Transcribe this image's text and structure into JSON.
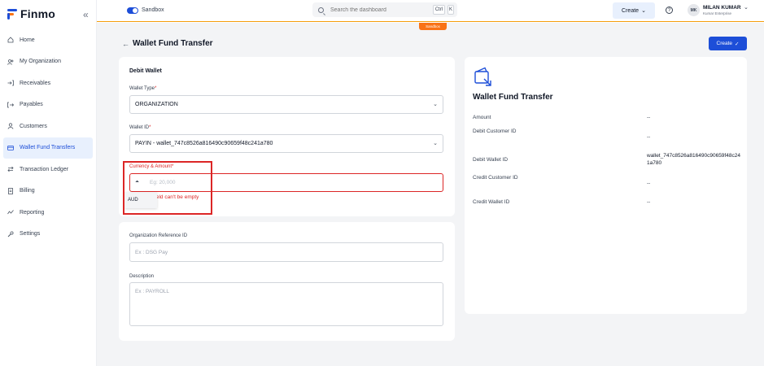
{
  "brand": {
    "name": "Finmo"
  },
  "sidebar": {
    "items": [
      {
        "label": "Home",
        "icon": "home-icon"
      },
      {
        "label": "My Organization",
        "icon": "users-icon"
      },
      {
        "label": "Receivables",
        "icon": "login-icon"
      },
      {
        "label": "Payables",
        "icon": "logout-icon"
      },
      {
        "label": "Customers",
        "icon": "user-icon"
      },
      {
        "label": "Wallet Fund Transfers",
        "icon": "card-icon",
        "active": true
      },
      {
        "label": "Transaction Ledger",
        "icon": "swap-icon"
      },
      {
        "label": "Billing",
        "icon": "document-icon"
      },
      {
        "label": "Reporting",
        "icon": "chart-icon"
      },
      {
        "label": "Settings",
        "icon": "wrench-icon"
      }
    ]
  },
  "topbar": {
    "sandbox_label": "Sandbox",
    "search_placeholder": "Search the dashboard",
    "shortcut_ctrl": "Ctrl",
    "shortcut_k": "K",
    "create_label": "Create",
    "user_initials": "MK",
    "user_name": "MILAN KUMAR",
    "user_org": "Kumar Enterprise",
    "sandbox_badge": "Sandbox"
  },
  "page": {
    "title": "Wallet Fund Transfer",
    "create_button": "Create"
  },
  "form": {
    "section_title": "Debit Wallet",
    "wallet_type_label": "Wallet Type",
    "wallet_type_value": "ORGANIZATION",
    "wallet_id_label": "Wallet ID",
    "wallet_id_value": "PAYIN - wallet_747c8526a816490c90659f48c241a780",
    "currency_amount_label": "Currency & Amount",
    "amount_placeholder": "Eg: 20,000",
    "currency_option": "AUD",
    "error_text": "t field can't be empty",
    "org_ref_label": "Organization Reference ID",
    "org_ref_placeholder": "Ex : DSG Pay",
    "description_label": "Description",
    "description_placeholder": "Ex : PAYROLL",
    "required_mark": "*"
  },
  "summary": {
    "title": "Wallet Fund Transfer",
    "amount_label": "Amount",
    "amount_value": "--",
    "debit_customer_label": "Debit Customer ID",
    "debit_customer_value": "--",
    "debit_wallet_label": "Debit Wallet ID",
    "debit_wallet_value": "wallet_747c8526a816490c90659f48c241a780",
    "credit_customer_label": "Credit Customer ID",
    "credit_customer_value": "--",
    "credit_wallet_label": "Credit Wallet ID",
    "credit_wallet_value": "--"
  },
  "colors": {
    "accent": "#1d4ed8",
    "error": "#dc2626",
    "badge": "#f97316"
  }
}
